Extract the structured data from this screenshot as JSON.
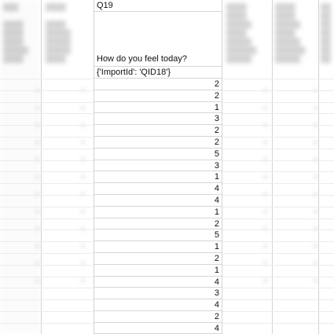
{
  "spreadsheet": {
    "focus_column": {
      "header": "Q19",
      "question": "How do you feel today?",
      "import_id": "{'ImportId': 'QID18'}",
      "values": [
        "2",
        "2",
        "1",
        "3",
        "2",
        "2",
        "5",
        "3",
        "1",
        "4",
        "4",
        "1",
        "2",
        "5",
        "1",
        "2",
        "1",
        "4",
        "3",
        "4",
        "2",
        "4"
      ]
    }
  },
  "colors": {
    "grid": "#d6d6d6",
    "background": "#ffffff"
  }
}
